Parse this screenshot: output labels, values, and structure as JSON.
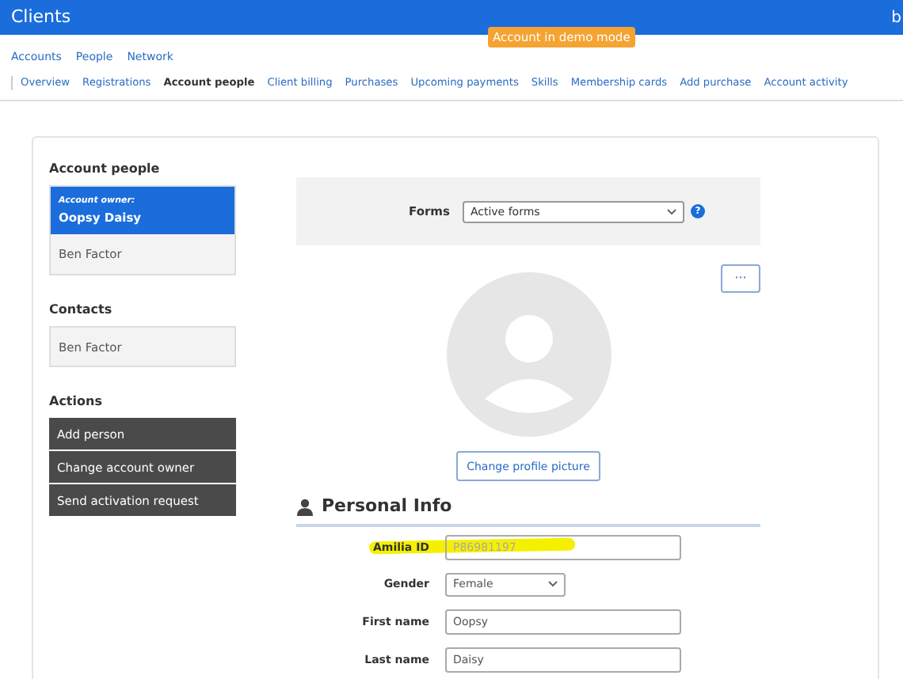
{
  "app_bar": {
    "title": "Clients",
    "cut_text": "b"
  },
  "demo_badge": "Account in demo mode",
  "nav_links": [
    "Accounts",
    "People",
    "Network"
  ],
  "tabs": [
    {
      "label": "Overview",
      "selected": false
    },
    {
      "label": "Registrations",
      "selected": false
    },
    {
      "label": "Account people",
      "selected": true
    },
    {
      "label": "Client billing",
      "selected": false
    },
    {
      "label": "Purchases",
      "selected": false
    },
    {
      "label": "Upcoming payments",
      "selected": false
    },
    {
      "label": "Skills",
      "selected": false
    },
    {
      "label": "Membership cards",
      "selected": false
    },
    {
      "label": "Add purchase",
      "selected": false
    },
    {
      "label": "Account activity",
      "selected": false
    }
  ],
  "sidebar": {
    "people_heading": "Account people",
    "people": [
      {
        "caption": "Account owner:",
        "name": "Oopsy Daisy",
        "selected": true
      },
      {
        "name": "Ben Factor",
        "selected": false
      }
    ],
    "contacts_heading": "Contacts",
    "contacts": [
      "Ben Factor"
    ],
    "actions_heading": "Actions",
    "actions": [
      "Add person",
      "Change account owner",
      "Send activation request"
    ]
  },
  "forms_bar": {
    "label": "Forms",
    "value": "Active forms",
    "help": "?"
  },
  "more_button": "···",
  "change_picture_button": "Change profile picture",
  "section_title": "Personal Info",
  "fields": [
    {
      "label": "Amilia ID",
      "kind": "text",
      "value": "P86981197",
      "disabled": true,
      "highlighted": true
    },
    {
      "label": "Gender",
      "kind": "select",
      "value": "Female",
      "highlighted": false
    },
    {
      "label": "First name",
      "kind": "text",
      "value": "Oopsy",
      "disabled": false,
      "highlighted": false
    },
    {
      "label": "Last name",
      "kind": "text",
      "value": "Daisy",
      "disabled": false,
      "highlighted": false
    }
  ]
}
